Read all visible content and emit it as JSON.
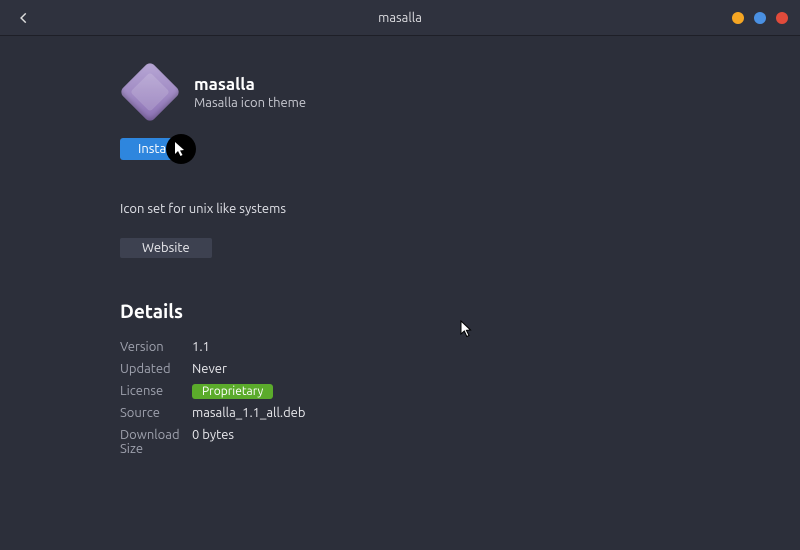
{
  "titlebar": {
    "title": "masalla"
  },
  "colors": {
    "minimize": "#f5a623",
    "maximize": "#4a90e2",
    "close": "#e14b3b"
  },
  "app": {
    "name": "masalla",
    "subtitle": "Masalla icon theme",
    "install_label": "Install",
    "description": "Icon set for unix like systems",
    "website_label": "Website"
  },
  "details": {
    "heading": "Details",
    "rows": {
      "version": {
        "label": "Version",
        "value": "1.1"
      },
      "updated": {
        "label": "Updated",
        "value": "Never"
      },
      "license": {
        "label": "License",
        "value": "Proprietary"
      },
      "source": {
        "label": "Source",
        "value": "masalla_1.1_all.deb"
      },
      "download": {
        "label": "Download Size",
        "value": "0 bytes"
      }
    }
  }
}
